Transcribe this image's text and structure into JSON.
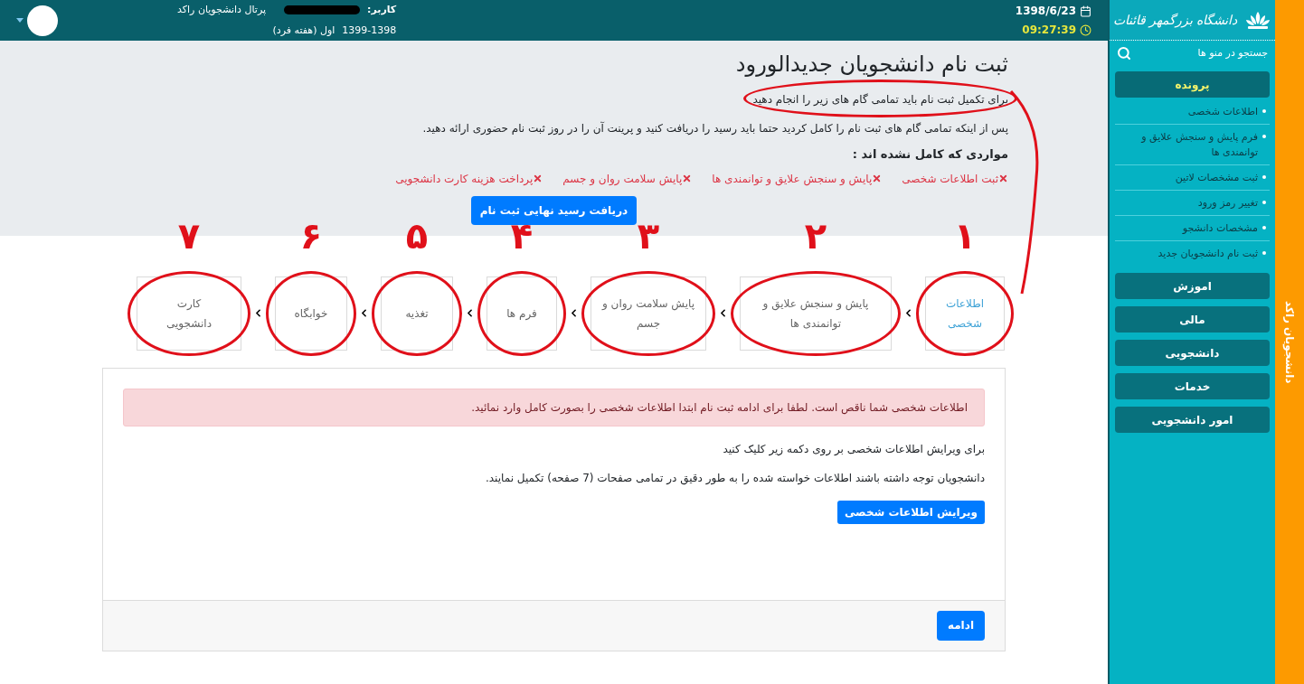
{
  "top_bar": {
    "user_label": "کاربر:",
    "portal": "پرتال دانشجویان راکد",
    "year": "1399-1398",
    "semester": "اول (هفته فرد)",
    "date": "1398/6/23",
    "time": "09:27:39"
  },
  "page": {
    "title": "ثبت نام دانشجویان جدیدالورود",
    "subtitle": "برای تکمیل ثبت نام باید تمامی گام های زیر را انجام دهید",
    "subtitle_circled": true,
    "instructions": "پس از اینکه تمامی گام های ثبت نام را کامل کردید حتما باید رسید را دریافت کنید و پرینت آن را در روز ثبت نام حضوری ارائه دهید.",
    "incomplete_heading": "مواردی که کامل نشده اند :",
    "incomplete_items": [
      "ثبت اطلاعات شخصی",
      "پایش و سنجش علایق و توانمندی ها",
      "پایش سلامت روان و جسم",
      "پرداخت هزینه کارت دانشجویی"
    ],
    "receipt_button": "دریافت رسید نهایی ثبت نام"
  },
  "steps": [
    {
      "label": "اطلاعات شخصی",
      "selected": true,
      "annotation": "۱",
      "circled": true
    },
    {
      "label": "پایش و سنجش علایق و توانمندی ها",
      "selected": false,
      "annotation": "۲",
      "circled": true
    },
    {
      "label": "پایش سلامت روان و جسم",
      "selected": false,
      "annotation": "۳",
      "circled": true
    },
    {
      "label": "فرم ها",
      "selected": false,
      "annotation": "۴",
      "circled": true
    },
    {
      "label": "تغذیه",
      "selected": false,
      "annotation": "۵",
      "circled": true
    },
    {
      "label": "خوابگاه",
      "selected": false,
      "annotation": "۶",
      "circled": true
    },
    {
      "label": "کارت دانشجویی",
      "selected": false,
      "annotation": "۷",
      "circled": true
    }
  ],
  "card": {
    "alert": "اطلاعات شخصی شما ناقص است. لطفا برای ادامه ثبت نام ابتدا اطلاعات شخصی را بصورت کامل وارد نمائید.",
    "edit_hint": "برای ویرایش اطلاعات شخصی بر روی دکمه زیر کلیک کنید",
    "note": "دانشجویان توجه داشته باشند اطلاعات خواسته شده را به طور دقیق در تمامی صفحات (7 صفحه) تکمیل نمایند.",
    "edit_button": "ویرایش اطلاعات شخصی",
    "continue_button": "ادامه"
  },
  "sidebar": {
    "logo_text": "دانشگاه بزرگمهر قائنات",
    "search_placeholder": "جستجو در منو ها",
    "side_tab": "دانشجویان راکد",
    "sections": [
      {
        "label": "پرونده",
        "selected": true,
        "children": [
          {
            "label": "اطلاعات شخصی"
          },
          {
            "label": "فرم پایش و سنجش علایق و توانمندی ها"
          },
          {
            "label": "ثبت مشخصات لاتین"
          },
          {
            "label": "تغییر رمز ورود"
          },
          {
            "label": "مشخصات دانشجو"
          },
          {
            "label": "ثبت نام دانشجویان جدید"
          }
        ]
      },
      {
        "label": "اموزش",
        "selected": false
      },
      {
        "label": "مالی",
        "selected": false
      },
      {
        "label": "دانشجویی",
        "selected": false
      },
      {
        "label": "خدمات",
        "selected": false
      },
      {
        "label": "امور دانشجویی",
        "selected": false
      }
    ]
  }
}
